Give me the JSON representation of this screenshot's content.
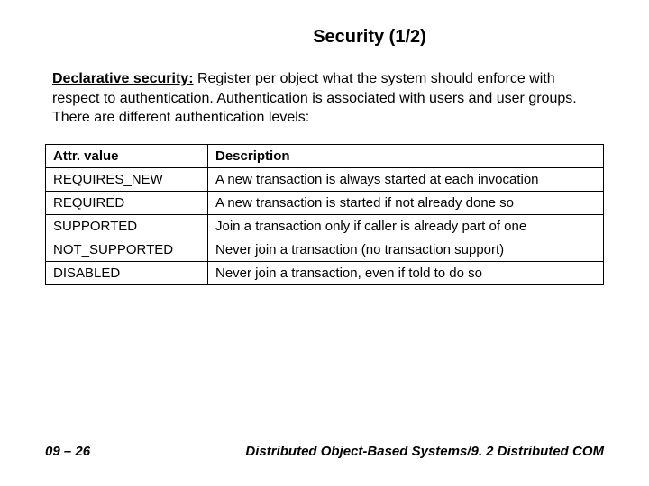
{
  "title": "Security (1/2)",
  "intro_lead": "Declarative security:",
  "intro_rest": " Register per object what the system should enforce with respect to authentication. Authentication is associated with users and user groups. There are different authentication levels:",
  "table": {
    "headers": {
      "attr": "Attr. value",
      "desc": "Description"
    },
    "rows": [
      {
        "attr": "REQUIRES_NEW",
        "desc": "A new transaction is always started at each invocation"
      },
      {
        "attr": "REQUIRED",
        "desc": "A new transaction is started if not already done so"
      },
      {
        "attr": "SUPPORTED",
        "desc": "Join a transaction only if caller is already part of one"
      },
      {
        "attr": "NOT_SUPPORTED",
        "desc": "Never join a transaction (no transaction support)"
      },
      {
        "attr": "DISABLED",
        "desc": "Never join a transaction, even if told to do so"
      }
    ]
  },
  "footer": {
    "left": "09 – 26",
    "right": "Distributed Object-Based Systems/9. 2 Distributed COM"
  }
}
